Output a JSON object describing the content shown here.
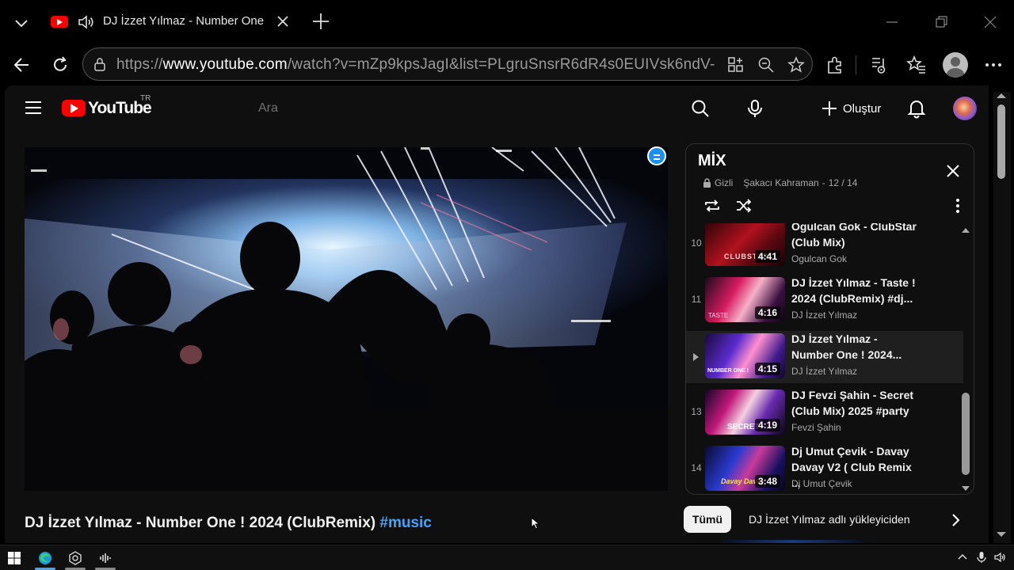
{
  "browser": {
    "tab": {
      "title": "DJ İzzet Yılmaz - Number One",
      "favicon": "youtube-icon",
      "audio_icon": "speaker-icon"
    },
    "url": {
      "scheme": "https://",
      "host": "www.youtube.com",
      "path": "/watch?v=mZp9kpsJagI&list=PLgruSnsrR6dR4s0EUIVsk6ndV-Y..."
    },
    "toolbar_icons": [
      "back-icon",
      "refresh-icon",
      "lock-icon",
      "app-grid-icon",
      "zoom-icon",
      "favorite-star-icon",
      "extensions-icon",
      "media-icon",
      "favorites-icon",
      "profile-icon",
      "more-icon"
    ]
  },
  "youtube": {
    "logo_text": "YouTube",
    "country_code": "TR",
    "search_placeholder": "Ara",
    "create_label": "Oluştur",
    "video_title": "DJ İzzet Yılmaz - Number One ! 2024 (ClubRemix)",
    "video_hashtag": "#music"
  },
  "playlist": {
    "title": "MİX",
    "privacy": "Gizli",
    "owner": "Şakacı Kahraman",
    "position": "12 / 14",
    "items": [
      {
        "index": "10",
        "title": "Ogulcan Gok - ClubStar (Club Mix)",
        "channel": "Ogulcan Gok",
        "duration": "4:41",
        "thumb_text": "CLUBSTAR"
      },
      {
        "index": "11",
        "title": "DJ İzzet Yılmaz - Taste ! 2024 (ClubRemix) #dj...",
        "channel": "DJ İzzet Yılmaz",
        "duration": "4:16",
        "thumb_text": "TASTE"
      },
      {
        "index": "",
        "title": "DJ İzzet Yılmaz - Number One ! 2024...",
        "channel": "DJ İzzet Yılmaz",
        "duration": "4:15",
        "thumb_text": "NUMBER ONE !",
        "now_playing": true
      },
      {
        "index": "13",
        "title": "DJ Fevzi Şahin - Secret (Club Mix) 2025 #party",
        "channel": "Fevzi Şahin",
        "duration": "4:19",
        "thumb_text": "SECRET"
      },
      {
        "index": "14",
        "title": "Dj Umut Çevik - Davay Davay V2 ( Club Remix ...",
        "channel": "Dj Umut Çevik",
        "duration": "3:48",
        "thumb_text": "Davay Davay"
      }
    ]
  },
  "chips": {
    "all": "Tümü",
    "from_uploader": "DJ İzzet Yılmaz adlı yükleyiciden"
  },
  "colors": {
    "youtube_red": "#ff0000",
    "hashtag_blue": "#3ea6ff",
    "page_bg": "#0f0f0f"
  }
}
